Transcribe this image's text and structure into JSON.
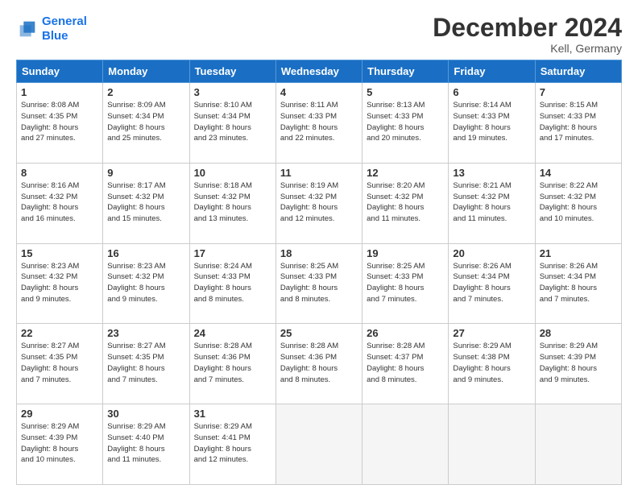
{
  "logo": {
    "line1": "General",
    "line2": "Blue"
  },
  "title": "December 2024",
  "location": "Kell, Germany",
  "headers": [
    "Sunday",
    "Monday",
    "Tuesday",
    "Wednesday",
    "Thursday",
    "Friday",
    "Saturday"
  ],
  "weeks": [
    [
      {
        "day": "1",
        "info": "Sunrise: 8:08 AM\nSunset: 4:35 PM\nDaylight: 8 hours\nand 27 minutes."
      },
      {
        "day": "2",
        "info": "Sunrise: 8:09 AM\nSunset: 4:34 PM\nDaylight: 8 hours\nand 25 minutes."
      },
      {
        "day": "3",
        "info": "Sunrise: 8:10 AM\nSunset: 4:34 PM\nDaylight: 8 hours\nand 23 minutes."
      },
      {
        "day": "4",
        "info": "Sunrise: 8:11 AM\nSunset: 4:33 PM\nDaylight: 8 hours\nand 22 minutes."
      },
      {
        "day": "5",
        "info": "Sunrise: 8:13 AM\nSunset: 4:33 PM\nDaylight: 8 hours\nand 20 minutes."
      },
      {
        "day": "6",
        "info": "Sunrise: 8:14 AM\nSunset: 4:33 PM\nDaylight: 8 hours\nand 19 minutes."
      },
      {
        "day": "7",
        "info": "Sunrise: 8:15 AM\nSunset: 4:33 PM\nDaylight: 8 hours\nand 17 minutes."
      }
    ],
    [
      {
        "day": "8",
        "info": "Sunrise: 8:16 AM\nSunset: 4:32 PM\nDaylight: 8 hours\nand 16 minutes."
      },
      {
        "day": "9",
        "info": "Sunrise: 8:17 AM\nSunset: 4:32 PM\nDaylight: 8 hours\nand 15 minutes."
      },
      {
        "day": "10",
        "info": "Sunrise: 8:18 AM\nSunset: 4:32 PM\nDaylight: 8 hours\nand 13 minutes."
      },
      {
        "day": "11",
        "info": "Sunrise: 8:19 AM\nSunset: 4:32 PM\nDaylight: 8 hours\nand 12 minutes."
      },
      {
        "day": "12",
        "info": "Sunrise: 8:20 AM\nSunset: 4:32 PM\nDaylight: 8 hours\nand 11 minutes."
      },
      {
        "day": "13",
        "info": "Sunrise: 8:21 AM\nSunset: 4:32 PM\nDaylight: 8 hours\nand 11 minutes."
      },
      {
        "day": "14",
        "info": "Sunrise: 8:22 AM\nSunset: 4:32 PM\nDaylight: 8 hours\nand 10 minutes."
      }
    ],
    [
      {
        "day": "15",
        "info": "Sunrise: 8:23 AM\nSunset: 4:32 PM\nDaylight: 8 hours\nand 9 minutes."
      },
      {
        "day": "16",
        "info": "Sunrise: 8:23 AM\nSunset: 4:32 PM\nDaylight: 8 hours\nand 9 minutes."
      },
      {
        "day": "17",
        "info": "Sunrise: 8:24 AM\nSunset: 4:33 PM\nDaylight: 8 hours\nand 8 minutes."
      },
      {
        "day": "18",
        "info": "Sunrise: 8:25 AM\nSunset: 4:33 PM\nDaylight: 8 hours\nand 8 minutes."
      },
      {
        "day": "19",
        "info": "Sunrise: 8:25 AM\nSunset: 4:33 PM\nDaylight: 8 hours\nand 7 minutes."
      },
      {
        "day": "20",
        "info": "Sunrise: 8:26 AM\nSunset: 4:34 PM\nDaylight: 8 hours\nand 7 minutes."
      },
      {
        "day": "21",
        "info": "Sunrise: 8:26 AM\nSunset: 4:34 PM\nDaylight: 8 hours\nand 7 minutes."
      }
    ],
    [
      {
        "day": "22",
        "info": "Sunrise: 8:27 AM\nSunset: 4:35 PM\nDaylight: 8 hours\nand 7 minutes."
      },
      {
        "day": "23",
        "info": "Sunrise: 8:27 AM\nSunset: 4:35 PM\nDaylight: 8 hours\nand 7 minutes."
      },
      {
        "day": "24",
        "info": "Sunrise: 8:28 AM\nSunset: 4:36 PM\nDaylight: 8 hours\nand 7 minutes."
      },
      {
        "day": "25",
        "info": "Sunrise: 8:28 AM\nSunset: 4:36 PM\nDaylight: 8 hours\nand 8 minutes."
      },
      {
        "day": "26",
        "info": "Sunrise: 8:28 AM\nSunset: 4:37 PM\nDaylight: 8 hours\nand 8 minutes."
      },
      {
        "day": "27",
        "info": "Sunrise: 8:29 AM\nSunset: 4:38 PM\nDaylight: 8 hours\nand 9 minutes."
      },
      {
        "day": "28",
        "info": "Sunrise: 8:29 AM\nSunset: 4:39 PM\nDaylight: 8 hours\nand 9 minutes."
      }
    ],
    [
      {
        "day": "29",
        "info": "Sunrise: 8:29 AM\nSunset: 4:39 PM\nDaylight: 8 hours\nand 10 minutes."
      },
      {
        "day": "30",
        "info": "Sunrise: 8:29 AM\nSunset: 4:40 PM\nDaylight: 8 hours\nand 11 minutes."
      },
      {
        "day": "31",
        "info": "Sunrise: 8:29 AM\nSunset: 4:41 PM\nDaylight: 8 hours\nand 12 minutes."
      },
      {
        "day": "",
        "info": ""
      },
      {
        "day": "",
        "info": ""
      },
      {
        "day": "",
        "info": ""
      },
      {
        "day": "",
        "info": ""
      }
    ]
  ]
}
